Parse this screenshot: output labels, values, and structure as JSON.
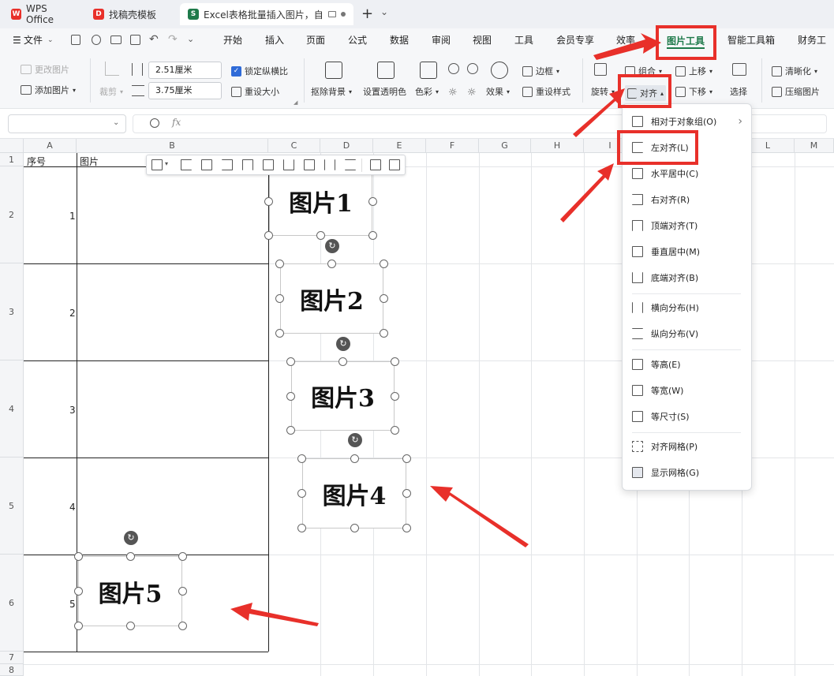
{
  "titlebar": {
    "tabs": [
      {
        "label": "WPS Office",
        "logo": "W"
      },
      {
        "label": "找稿壳模板",
        "logo": "D"
      },
      {
        "label": "Excel表格批量插入图片，自动",
        "logo": "S"
      }
    ],
    "new_tab": "+",
    "new_tab_menu": "⌄"
  },
  "menubar": {
    "file_label": "文件",
    "quick_icons": [
      "save-icon",
      "share-icon",
      "print-icon",
      "preview-icon",
      "undo-icon",
      "redo-icon",
      "more-icon"
    ],
    "tabs": [
      "开始",
      "插入",
      "页面",
      "公式",
      "数据",
      "审阅",
      "视图",
      "工具",
      "会员专享",
      "效率",
      "图片工具",
      "智能工具箱",
      "财务工具"
    ],
    "active_tab": "图片工具"
  },
  "ribbon": {
    "change_picture": "更改图片",
    "add_picture": "添加图片",
    "crop": "裁剪",
    "height_value": "2.51厘米",
    "width_value": "3.75厘米",
    "lock_ratio": "锁定纵横比",
    "reset_size": "重设大小",
    "remove_bg": "抠除背景",
    "set_transparent": "设置透明色",
    "color": "色彩",
    "effects": "效果",
    "border": "边框",
    "reset_style": "重设样式",
    "rotate": "旋转",
    "group": "组合",
    "align": "对齐",
    "bring_forward": "上移",
    "send_backward": "下移",
    "select": "选择",
    "sharpen": "清晰化",
    "compress": "压缩图片"
  },
  "formula_bar": {
    "name_box": "",
    "fx": "fx",
    "zoom_icon": "zoom-icon"
  },
  "grid": {
    "columns": [
      "A",
      "B",
      "C",
      "D",
      "E",
      "F",
      "G",
      "H",
      "I",
      "J",
      "K",
      "L",
      "M"
    ],
    "rows": [
      "1",
      "2",
      "3",
      "4",
      "5",
      "6",
      "7",
      "8"
    ],
    "header_a": "序号",
    "header_b": "图片",
    "numbers": [
      "1",
      "2",
      "3",
      "4",
      "5"
    ]
  },
  "pictures": [
    "图片1",
    "图片2",
    "图片3",
    "图片4",
    "图片5"
  ],
  "dropdown": {
    "items": [
      {
        "label": "相对于对象组(O)",
        "icon": "relative-icon",
        "submenu": "›"
      },
      {
        "label": "左对齐(L)",
        "icon": "align-left-icon"
      },
      {
        "label": "水平居中(C)",
        "icon": "align-center-icon"
      },
      {
        "label": "右对齐(R)",
        "icon": "align-right-icon"
      },
      {
        "label": "顶端对齐(T)",
        "icon": "align-top-icon"
      },
      {
        "label": "垂直居中(M)",
        "icon": "align-middle-icon"
      },
      {
        "label": "底端对齐(B)",
        "icon": "align-bottom-icon"
      },
      {
        "label": "横向分布(H)",
        "icon": "distribute-h-icon"
      },
      {
        "label": "纵向分布(V)",
        "icon": "distribute-v-icon"
      },
      {
        "label": "等高(E)",
        "icon": "same-height-icon"
      },
      {
        "label": "等宽(W)",
        "icon": "same-width-icon"
      },
      {
        "label": "等尺寸(S)",
        "icon": "same-size-icon"
      },
      {
        "label": "对齐网格(P)",
        "icon": "snap-grid-icon"
      },
      {
        "label": "显示网格(G)",
        "icon": "show-grid-icon"
      }
    ]
  },
  "colors": {
    "highlight": "#e8302a",
    "accent": "#1e7a4a",
    "selected_blue": "#2f6bd8"
  }
}
